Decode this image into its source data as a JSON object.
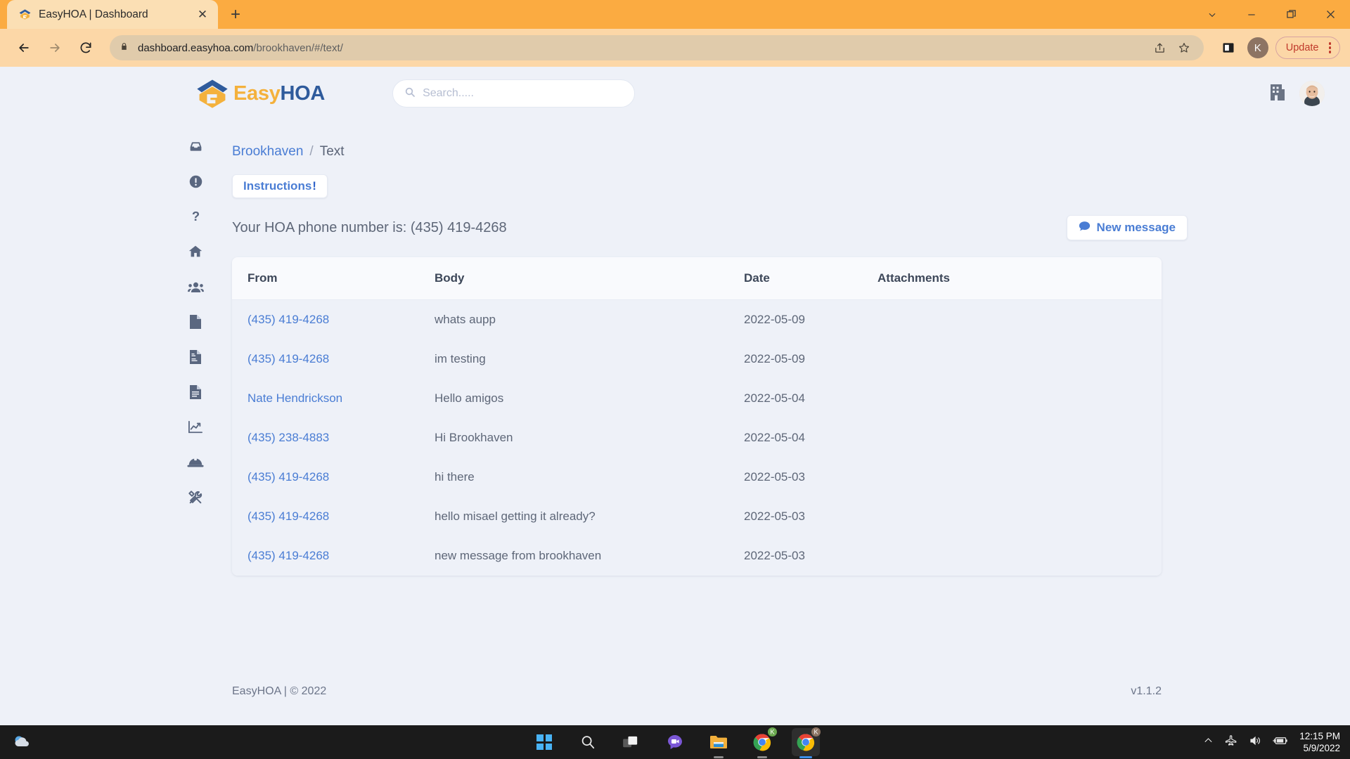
{
  "browser": {
    "tab": {
      "title": "EasyHOA | Dashboard",
      "favicon_icon": "easyhoa-favicon",
      "close_icon": "close-icon"
    },
    "new_tab_icon": "plus-icon",
    "window_controls": [
      {
        "name": "tab-search-button",
        "icon": "chevron-down-icon",
        "glyph": "⌄"
      },
      {
        "name": "minimize-button",
        "icon": "minimize-icon",
        "glyph": "—"
      },
      {
        "name": "maximize-button",
        "icon": "maximize-icon",
        "glyph": "❐"
      },
      {
        "name": "close-window-button",
        "icon": "close-icon",
        "glyph": "✕"
      }
    ],
    "back_icon": "back-arrow-icon",
    "forward_icon": "forward-arrow-icon",
    "reload_icon": "reload-icon",
    "lock_icon": "lock-icon",
    "url_host": "dashboard.easyhoa.com",
    "url_path": "/brookhaven/#/text/",
    "share_icon": "share-icon",
    "bookmark_icon": "star-icon",
    "sidepanel_icon": "side-panel-icon",
    "profile_initial": "K",
    "update_label": "Update",
    "menu_icon": "kebab-menu-icon"
  },
  "app": {
    "logo": {
      "text_easy": "Easy",
      "text_hoa": "HOA",
      "icon": "easyhoa-logo-icon"
    },
    "search": {
      "placeholder": "Search.....",
      "icon": "search-icon"
    },
    "header_icons": [
      {
        "name": "building-icon",
        "label": "building-icon"
      },
      {
        "name": "avatar",
        "label": "user-avatar"
      }
    ]
  },
  "sidebar": {
    "items": [
      {
        "name": "sidebar-item-inbox",
        "icon": "inbox-icon"
      },
      {
        "name": "sidebar-item-alerts",
        "icon": "exclamation-circle-icon"
      },
      {
        "name": "sidebar-item-help",
        "icon": "question-mark-icon"
      },
      {
        "name": "sidebar-item-home",
        "icon": "home-icon"
      },
      {
        "name": "sidebar-item-residents",
        "icon": "users-icon"
      },
      {
        "name": "sidebar-item-documents",
        "icon": "document-icon"
      },
      {
        "name": "sidebar-item-invoices",
        "icon": "invoice-icon"
      },
      {
        "name": "sidebar-item-reports",
        "icon": "document-lines-icon"
      },
      {
        "name": "sidebar-item-analytics",
        "icon": "chart-line-icon"
      },
      {
        "name": "sidebar-item-maintenance",
        "icon": "hard-hat-icon"
      },
      {
        "name": "sidebar-item-tools",
        "icon": "tools-icon"
      }
    ]
  },
  "main": {
    "breadcrumb": {
      "parent": "Brookhaven",
      "separator": "/",
      "current": "Text"
    },
    "instructions_label": "Instructions",
    "instructions_bang": "!",
    "phone_line": "Your HOA phone number is: (435) 419-4268",
    "new_message_label": "New message",
    "new_message_icon": "chat-bubble-icon",
    "table": {
      "columns": [
        "From",
        "Body",
        "Date",
        "Attachments"
      ],
      "rows": [
        {
          "from": "(435) 419-4268",
          "body": "whats aupp",
          "date": "2022-05-09",
          "attachments": ""
        },
        {
          "from": "(435) 419-4268",
          "body": "im testing",
          "date": "2022-05-09",
          "attachments": ""
        },
        {
          "from": "Nate Hendrickson",
          "body": "Hello amigos",
          "date": "2022-05-04",
          "attachments": ""
        },
        {
          "from": "(435) 238-4883",
          "body": "Hi Brookhaven",
          "date": "2022-05-04",
          "attachments": ""
        },
        {
          "from": "(435) 419-4268",
          "body": "hi there",
          "date": "2022-05-03",
          "attachments": ""
        },
        {
          "from": "(435) 419-4268",
          "body": "hello misael getting it already?",
          "date": "2022-05-03",
          "attachments": ""
        },
        {
          "from": "(435) 419-4268",
          "body": "new message from brookhaven",
          "date": "2022-05-03",
          "attachments": ""
        }
      ]
    }
  },
  "footer": {
    "left": "EasyHOA | © 2022",
    "version": "v1.1.2"
  },
  "taskbar": {
    "weather_icon": "weather-cloud-icon",
    "items": [
      {
        "name": "start-button",
        "icon": "windows-logo-icon"
      },
      {
        "name": "search-taskbar-button",
        "icon": "search-icon"
      },
      {
        "name": "task-view-button",
        "icon": "task-view-icon"
      },
      {
        "name": "chat-button",
        "icon": "teams-chat-icon"
      },
      {
        "name": "file-explorer-button",
        "icon": "folder-icon"
      },
      {
        "name": "chrome-window-1-button",
        "icon": "chrome-icon"
      },
      {
        "name": "chrome-window-2-button",
        "icon": "chrome-icon"
      }
    ],
    "tray": {
      "overflow_icon": "chevron-up-icon",
      "airplane_icon": "airplane-mode-icon",
      "volume_icon": "volume-icon",
      "battery_icon": "battery-charging-icon",
      "time": "12:15 PM",
      "date": "5/9/2022"
    }
  },
  "colors": {
    "browser_accent": "#fbab41",
    "page_bg": "#eef1f8",
    "link_blue": "#4a7dd4",
    "logo_yellow": "#f4b13c",
    "logo_blue": "#2f5b9c"
  }
}
